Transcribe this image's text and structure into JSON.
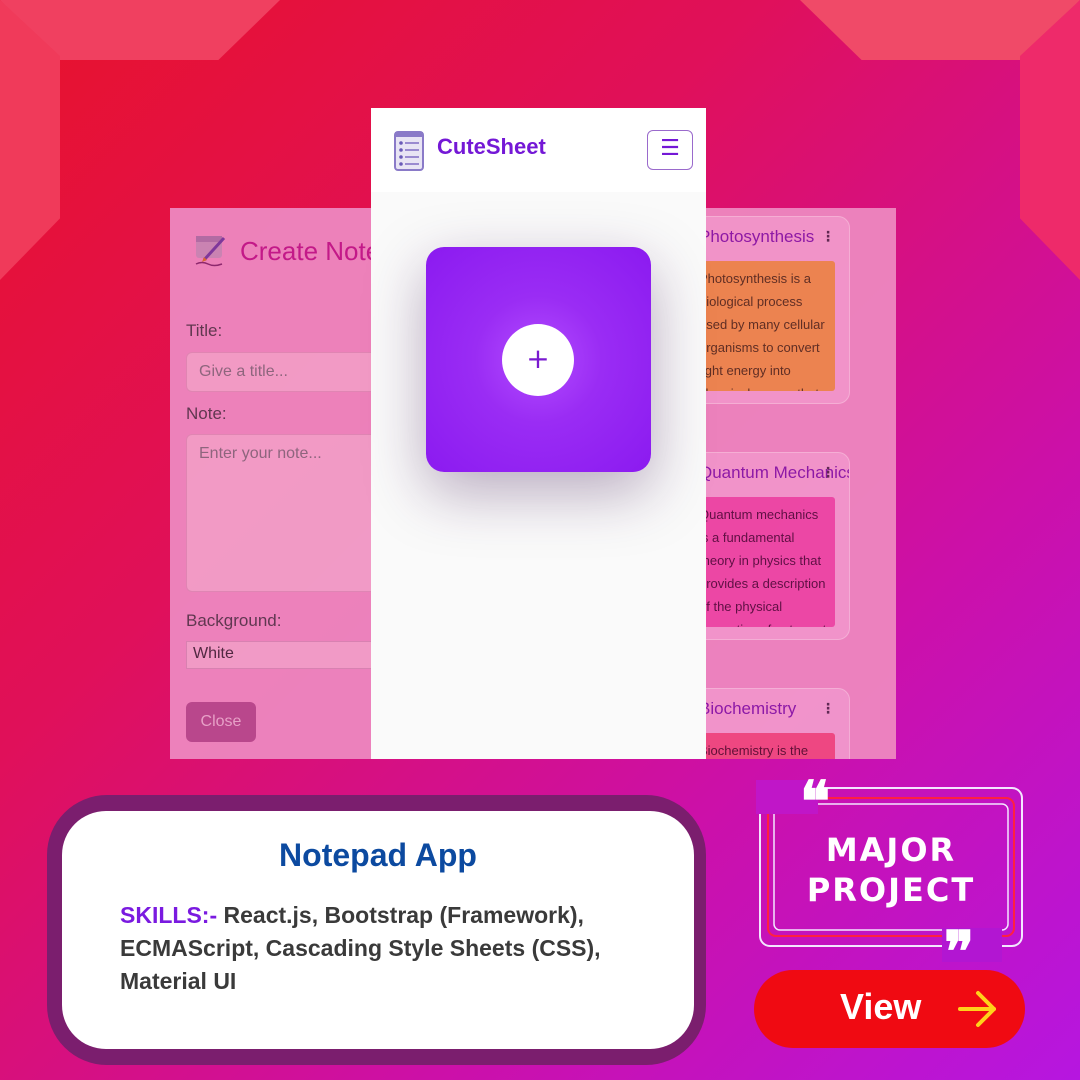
{
  "colors": {
    "brand": "#7418d6",
    "card_purple": "#9a2cf4",
    "view_button": "#f00a12",
    "info_title": "#0c4aa0"
  },
  "background_app": {
    "create_title": "Create Note",
    "title_label": "Title:",
    "title_placeholder": "Give a title...",
    "note_label": "Note:",
    "note_placeholder": "Enter your note...",
    "background_label": "Background:",
    "background_value": "White",
    "close_label": "Close",
    "notes": [
      {
        "title": "Photosynthesis",
        "body": "Photosynthesis is a biological process used by many cellular organisms to convert light energy into chemical energy that"
      },
      {
        "title": "Quantum Mechanics",
        "body": "Quantum mechanics is a fundamental theory in physics that provides a description of the physical properties of nature at"
      },
      {
        "title": "Biochemistry",
        "body": "Biochemistry is the study of chemical processes"
      }
    ]
  },
  "phone": {
    "brand": "CuteSheet",
    "menu_icon": "hamburger-icon",
    "add_icon": "plus-icon",
    "add_symbol": "+"
  },
  "info": {
    "title": "Notepad App",
    "skills_label": "SKILLS:-",
    "skills": "React.js, Bootstrap (Framework), ECMAScript, Cascading Style Sheets (CSS), Material UI"
  },
  "badge": {
    "line1": "MAJOR",
    "line2": "PROJECT"
  },
  "view_button": {
    "label": "View",
    "icon": "arrow-right-icon"
  }
}
